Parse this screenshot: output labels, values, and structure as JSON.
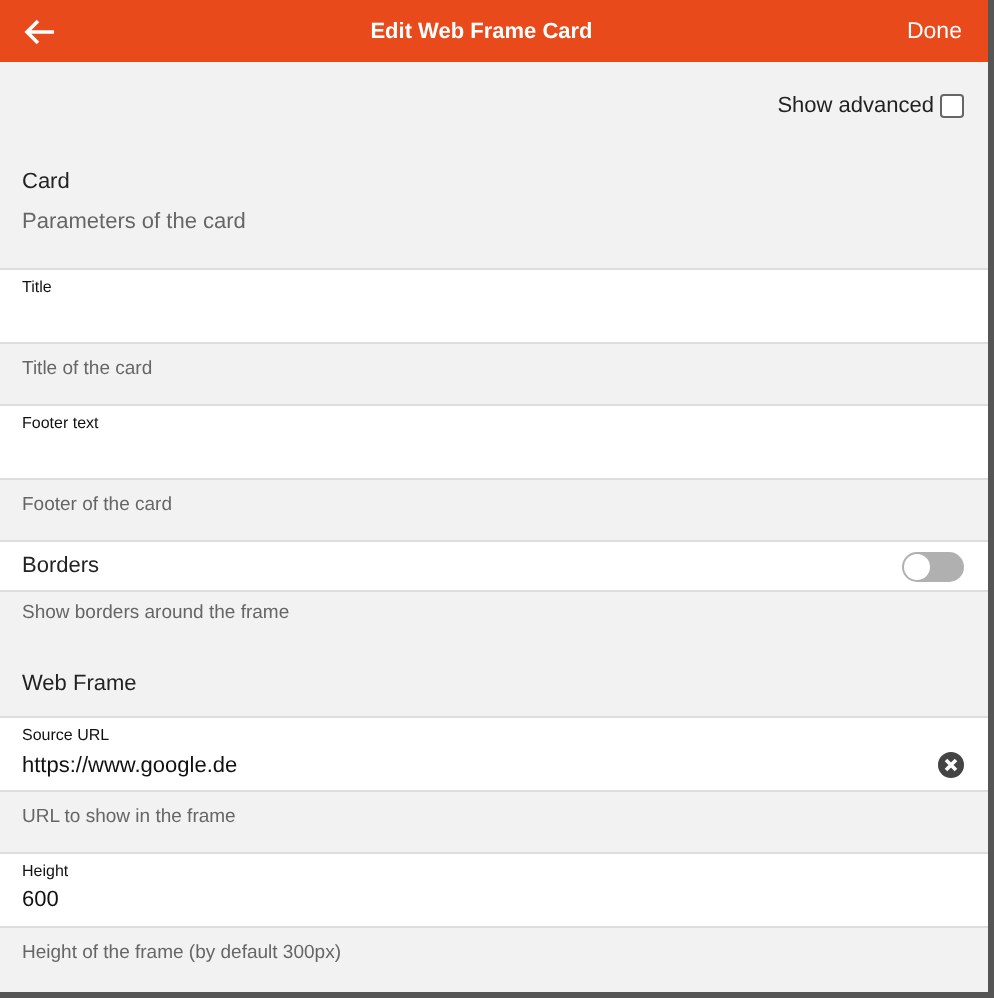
{
  "header": {
    "title": "Edit Web Frame Card",
    "action": "Done"
  },
  "show_advanced": {
    "label": "Show advanced",
    "checked": false
  },
  "sections": [
    {
      "title": "Card",
      "subtitle": "Parameters of the card",
      "items": [
        {
          "kind": "text_field",
          "label": "Title",
          "description": "Title of the card"
        },
        {
          "kind": "text_field",
          "label": "Footer text",
          "description": "Footer of the card"
        },
        {
          "kind": "toggle",
          "label": "Borders",
          "on": false,
          "description": "Show borders around the frame"
        }
      ]
    },
    {
      "title": "Web Frame",
      "items": [
        {
          "kind": "text_field",
          "label": "Source URL",
          "value": "https://www.google.de",
          "clearable": true,
          "description": "URL to show in the frame"
        },
        {
          "kind": "text_field",
          "label": "Height",
          "value": "600",
          "description": "Height of the frame (by default 300px)"
        }
      ]
    }
  ]
}
